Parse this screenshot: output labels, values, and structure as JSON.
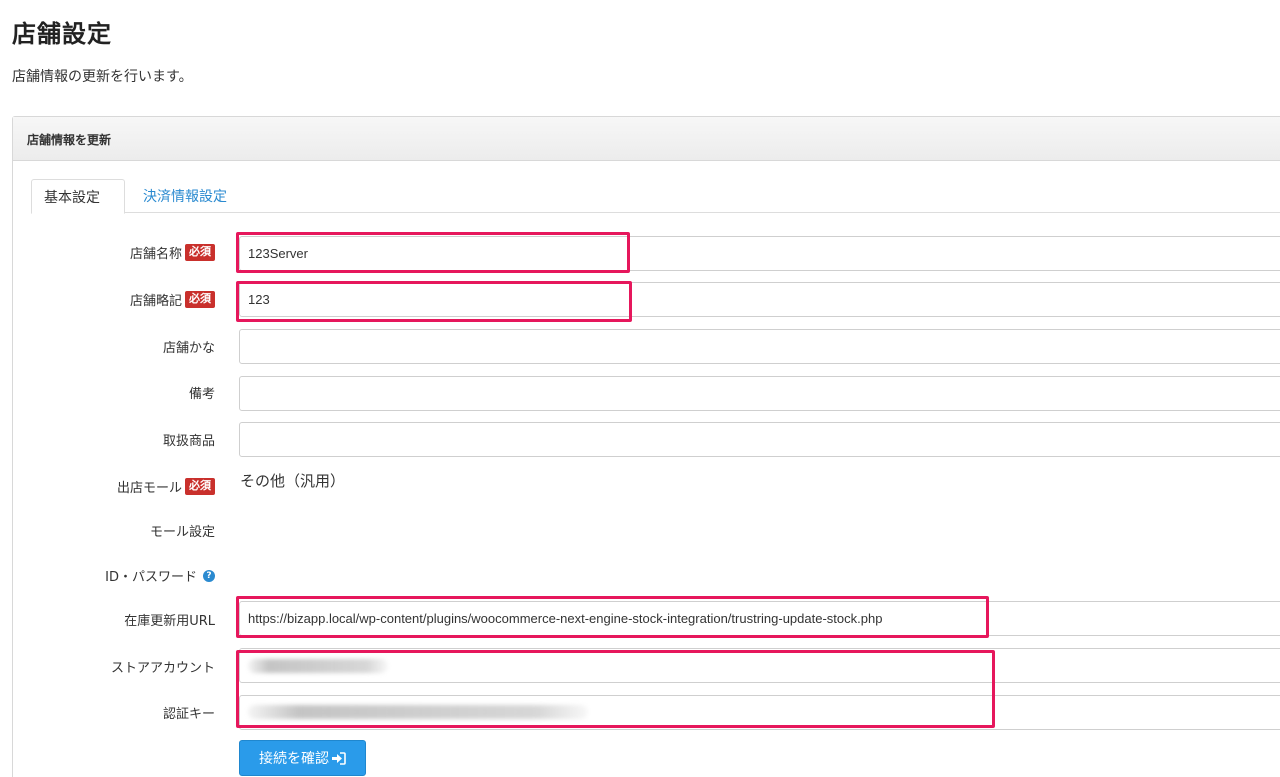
{
  "page": {
    "title": "店舗設定",
    "description": "店舗情報の更新を行います。"
  },
  "panel": {
    "heading": "店舗情報を更新"
  },
  "tabs": [
    {
      "label": "基本設定",
      "active": true
    },
    {
      "label": "決済情報設定",
      "active": false
    }
  ],
  "required_badge": "必須",
  "form": {
    "store_name": {
      "label": "店舗名称",
      "value": "123Server"
    },
    "store_abbr": {
      "label": "店舗略記",
      "value": "123"
    },
    "store_kana": {
      "label": "店舗かな",
      "value": ""
    },
    "remarks": {
      "label": "備考",
      "value": ""
    },
    "products": {
      "label": "取扱商品",
      "value": ""
    },
    "mall": {
      "label": "出店モール",
      "value": "その他（汎用）"
    },
    "mall_settings": {
      "label": "モール設定"
    },
    "id_password": {
      "label": "ID・パスワード"
    },
    "stock_url": {
      "label": "在庫更新用URL",
      "value": "https://bizapp.local/wp-content/plugins/woocommerce-next-engine-stock-integration/trustring-update-stock.php"
    },
    "store_account": {
      "label": "ストアアカウント"
    },
    "auth_key": {
      "label": "認証キー"
    }
  },
  "buttons": {
    "confirm_connection": "接続を確認"
  },
  "colors": {
    "highlight": "#e6175c",
    "required_badge": "#c9302c",
    "primary_button": "#2a9bea",
    "tab_link": "#2a8ad0"
  }
}
